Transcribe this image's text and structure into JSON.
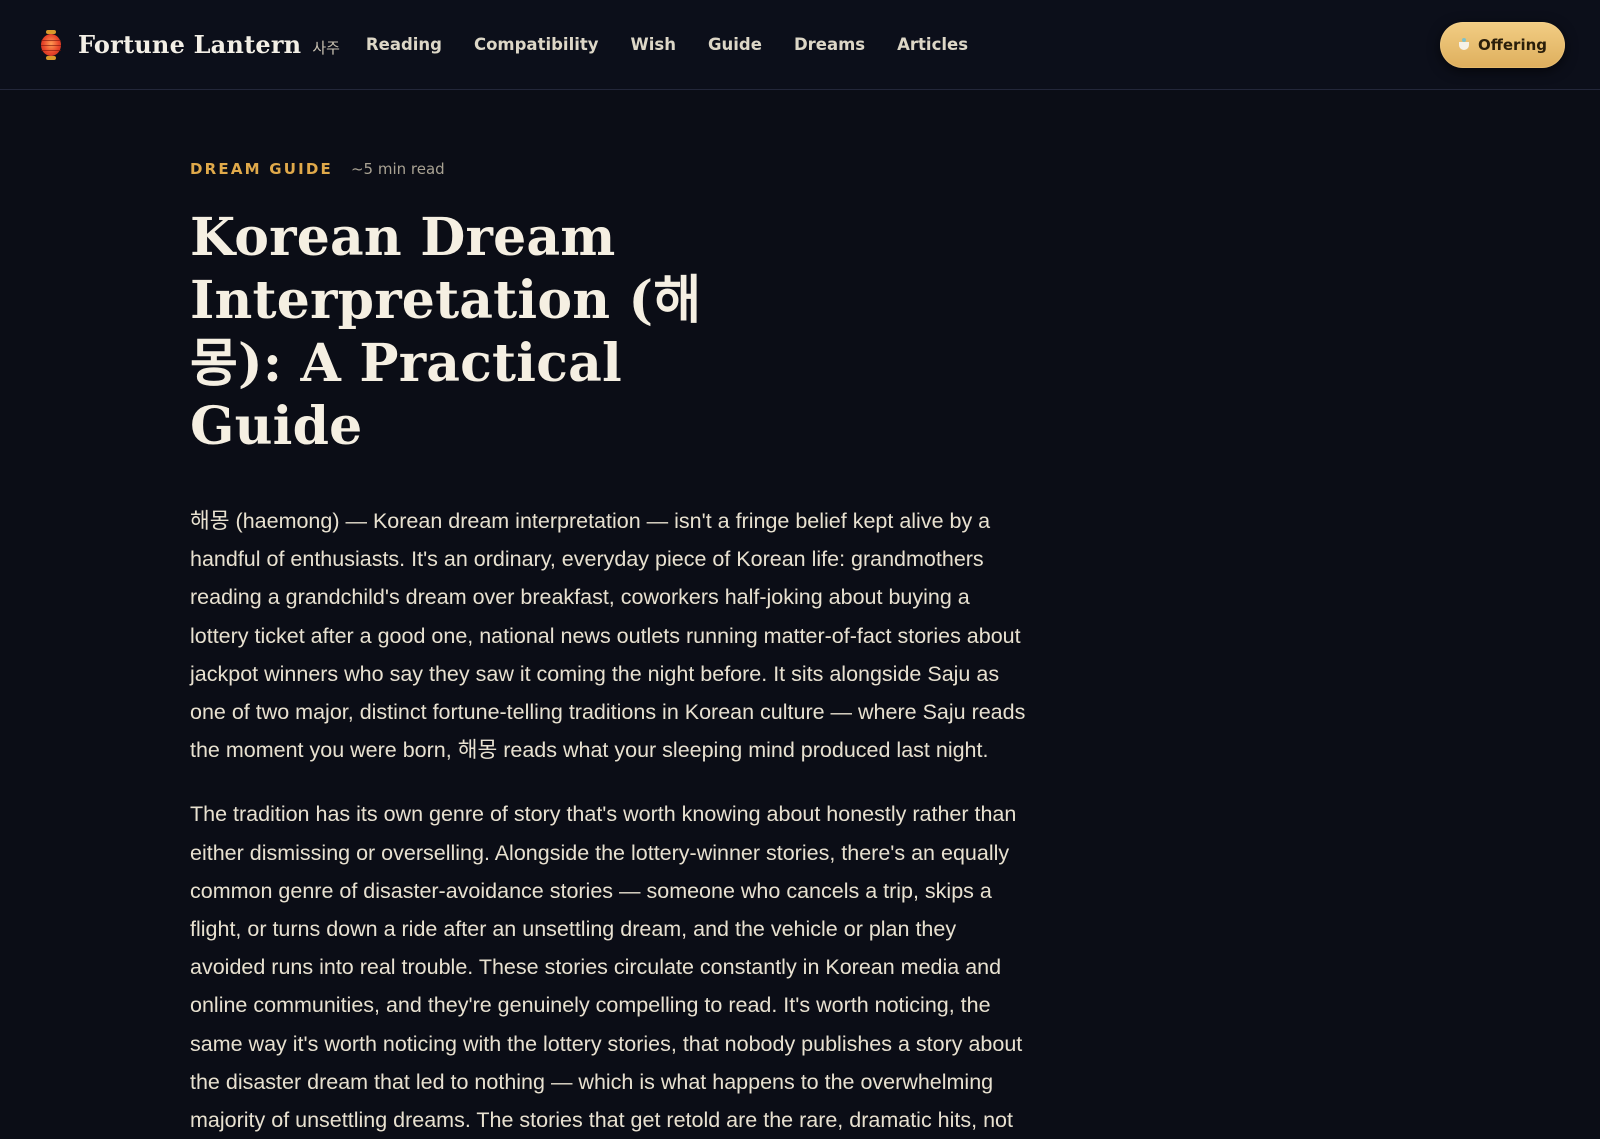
{
  "header": {
    "brand_name": "Fortune Lantern",
    "brand_sub": "사주",
    "nav": [
      "Reading",
      "Compatibility",
      "Wish",
      "Guide",
      "Dreams",
      "Articles"
    ],
    "offering_label": "Offering",
    "offering_icon": "tea-cup-icon"
  },
  "article": {
    "category": "DREAM GUIDE",
    "read_time": "~5 min read",
    "title": "Korean Dream Interpretation (해몽): A Practical Guide",
    "paragraphs": [
      "해몽 (haemong) — Korean dream interpretation — isn't a fringe belief kept alive by a handful of enthusiasts. It's an ordinary, everyday piece of Korean life: grandmothers reading a grandchild's dream over breakfast, coworkers half-joking about buying a lottery ticket after a good one, national news outlets running matter-of-fact stories about jackpot winners who say they saw it coming the night before. It sits alongside Saju as one of two major, distinct fortune-telling traditions in Korean culture — where Saju reads the moment you were born, 해몽 reads what your sleeping mind produced last night.",
      "The tradition has its own genre of story that's worth knowing about honestly rather than either dismissing or overselling. Alongside the lottery-winner stories, there's an equally common genre of disaster-avoidance stories — someone who cancels a trip, skips a flight, or turns down a ride after an unsettling dream, and the vehicle or plan they avoided runs into real trouble. These stories circulate constantly in Korean media and online communities, and they're genuinely compelling to read. It's worth noticing, the same way it's worth noticing with the lottery stories, that nobody publishes a story about the disaster dream that led to nothing — which is what happens to the overwhelming majority of unsettling dreams. The stories that get retold are the rare, dramatic hits, not"
    ]
  },
  "colors": {
    "background": "#0b0d16",
    "accent": "#e0a94a",
    "button": "#e6b868"
  }
}
